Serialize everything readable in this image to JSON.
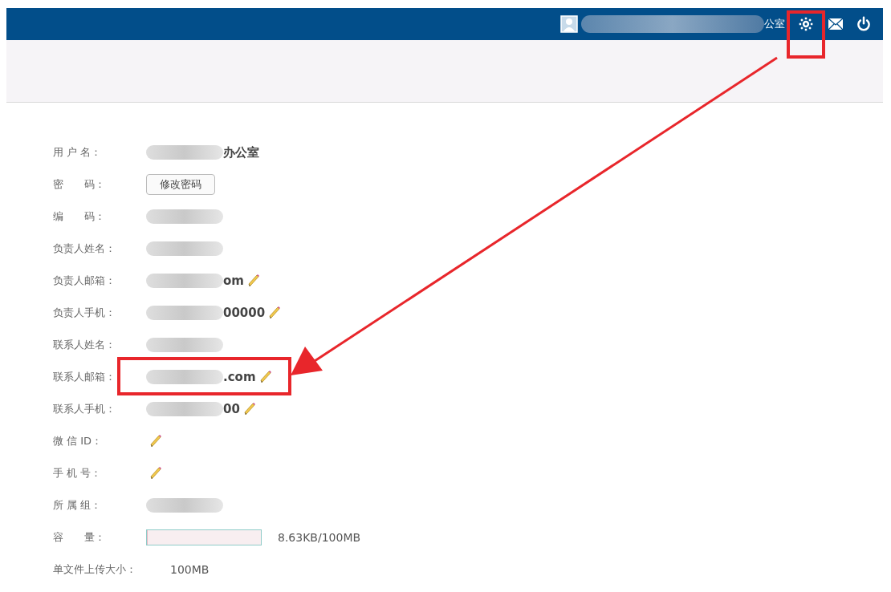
{
  "header": {
    "user_name_suffix": "公室",
    "settings_highlighted": true
  },
  "rows": [
    {
      "label": "用 户 名：",
      "kind": "text",
      "redacted": true,
      "value": "办公室",
      "editable": false,
      "highlighted": false
    },
    {
      "label": "密　　码：",
      "kind": "button",
      "value": "修改密码",
      "editable": false,
      "highlighted": false
    },
    {
      "label": "编　　码：",
      "kind": "text",
      "redacted": true,
      "editable": false,
      "highlighted": false
    },
    {
      "label": "负责人姓名：",
      "kind": "text",
      "redacted": true,
      "editable": false,
      "highlighted": false
    },
    {
      "label": "负责人邮箱：",
      "kind": "text",
      "redacted": true,
      "value": "om",
      "editable": true,
      "highlighted": false
    },
    {
      "label": "负责人手机：",
      "kind": "text",
      "redacted": true,
      "value": "00000",
      "editable": true,
      "highlighted": false
    },
    {
      "label": "联系人姓名：",
      "kind": "text",
      "redacted": true,
      "editable": false,
      "highlighted": false
    },
    {
      "label": "联系人邮箱：",
      "kind": "text",
      "redacted": true,
      "value": ".com",
      "editable": true,
      "highlighted": true
    },
    {
      "label": "联系人手机：",
      "kind": "text",
      "redacted": true,
      "value": "00",
      "editable": true,
      "highlighted": false
    },
    {
      "label": "微 信 ID：",
      "kind": "text",
      "editable": true,
      "highlighted": false
    },
    {
      "label": "手 机 号：",
      "kind": "text",
      "editable": true,
      "highlighted": false
    },
    {
      "label": "所 属 组：",
      "kind": "text",
      "redacted": true,
      "editable": false,
      "highlighted": false
    },
    {
      "label": "容　　量：",
      "kind": "capacity",
      "level": 0.01,
      "value": "8.63KB/100MB",
      "editable": false,
      "highlighted": false
    },
    {
      "label": "单文件上传大小：",
      "kind": "plain",
      "value": "100MB",
      "editable": false,
      "highlighted": false
    }
  ]
}
